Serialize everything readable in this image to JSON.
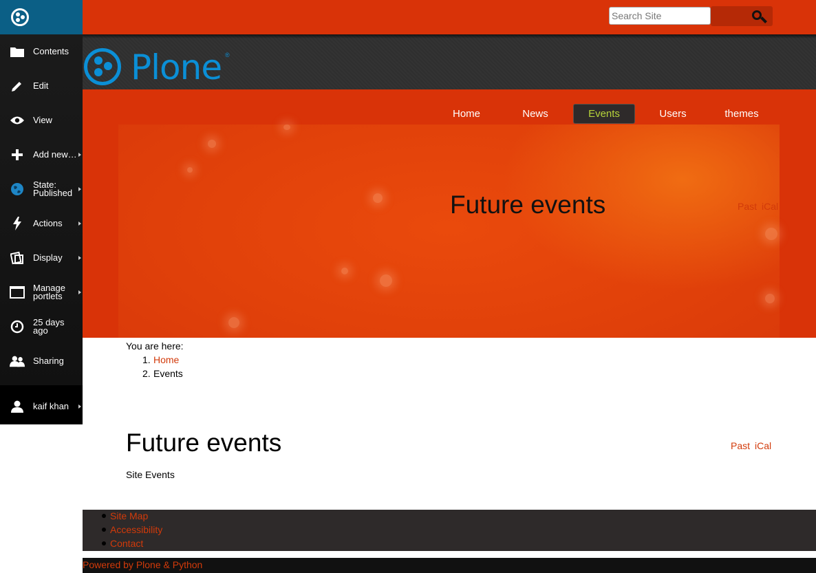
{
  "toolbar": {
    "items": [
      {
        "label": "Contents",
        "icon": "folder-icon"
      },
      {
        "label": "Edit",
        "icon": "pencil-icon"
      },
      {
        "label": "View",
        "icon": "eye-icon"
      },
      {
        "label": "Add new…",
        "icon": "plus-icon"
      },
      {
        "label": "State:\nPublished",
        "icon": "globe-icon"
      },
      {
        "label": "Actions",
        "icon": "bolt-icon"
      },
      {
        "label": "Display",
        "icon": "display-icon"
      },
      {
        "label": "Manage\nportlets",
        "icon": "window-icon"
      },
      {
        "label": "25 days\nago",
        "icon": "clock-icon"
      },
      {
        "label": "Sharing",
        "icon": "people-icon"
      }
    ],
    "user": "kaif khan"
  },
  "header": {
    "search_placeholder": "Search Site",
    "logo_text": "Plone",
    "logo_mark": "®"
  },
  "nav": {
    "items": [
      "Home",
      "News",
      "Events",
      "Users",
      "themes"
    ],
    "active": "Events"
  },
  "hero": {
    "title": "Future events",
    "link_past": "Past",
    "link_ical": "iCal"
  },
  "breadcrumbs": {
    "label": "You are here:",
    "items": [
      {
        "num": "1.",
        "text": "Home"
      },
      {
        "num": "2.",
        "text": "Events"
      }
    ]
  },
  "content": {
    "title": "Future events",
    "link_past": "Past",
    "link_ical": "iCal",
    "description": "Site Events"
  },
  "footer": {
    "links": [
      "Site Map",
      "Accessibility",
      "Contact"
    ],
    "colophon": "Powered by Plone & Python"
  },
  "colors": {
    "brand_red": "#d93308",
    "link_red": "#d23a0a",
    "plone_blue": "#0b8fd6",
    "active_nav_text": "#b6d33a"
  }
}
